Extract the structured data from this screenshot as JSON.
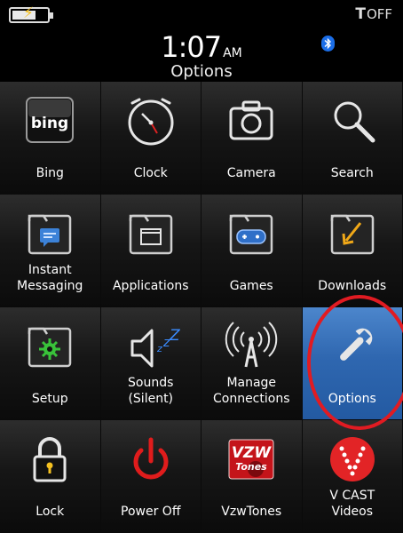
{
  "status_bar": {
    "time": "1:07",
    "ampm": "AM",
    "signal_text": "OFF",
    "signal_symbol": "T",
    "title": "Options"
  },
  "apps": [
    {
      "label": "Bing",
      "icon": "bing-icon"
    },
    {
      "label": "Clock",
      "icon": "clock-icon"
    },
    {
      "label": "Camera",
      "icon": "camera-icon"
    },
    {
      "label": "Search",
      "icon": "search-icon"
    },
    {
      "label": "Instant Messaging",
      "icon": "instant-messaging-icon"
    },
    {
      "label": "Applications",
      "icon": "applications-folder-icon"
    },
    {
      "label": "Games",
      "icon": "games-folder-icon"
    },
    {
      "label": "Downloads",
      "icon": "downloads-folder-icon"
    },
    {
      "label": "Setup",
      "icon": "setup-folder-icon"
    },
    {
      "label": "Sounds (Silent)",
      "icon": "sounds-icon"
    },
    {
      "label": "Manage Connections",
      "icon": "manage-connections-icon"
    },
    {
      "label": "Options",
      "icon": "options-wrench-icon",
      "selected": true
    },
    {
      "label": "Lock",
      "icon": "lock-icon"
    },
    {
      "label": "Power Off",
      "icon": "power-off-icon"
    },
    {
      "label": "VzwTones",
      "icon": "vzwtones-icon",
      "icon_text": [
        "VZW",
        "Tones"
      ]
    },
    {
      "label": "V CAST Videos",
      "icon": "vcast-videos-icon"
    }
  ],
  "bing_logo_text": "bing",
  "colors": {
    "selection": "#2f67b0",
    "highlight_ring": "#e11b22",
    "bluetooth": "#1b6ee8",
    "battery_bolt": "#f4c020"
  }
}
